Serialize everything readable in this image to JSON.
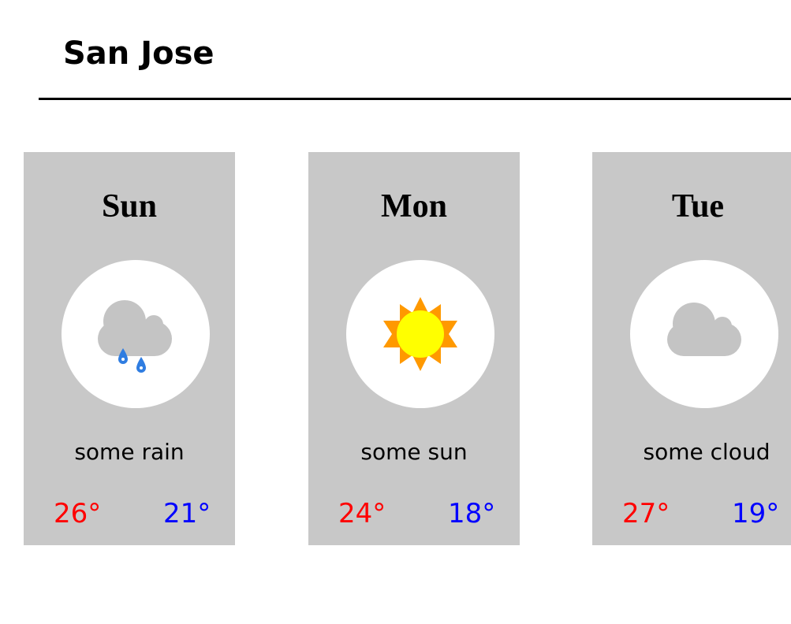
{
  "city": "San Jose",
  "days": [
    {
      "day": "Sun",
      "condition": "some rain",
      "high": "26°",
      "low": "21°",
      "icon": "rain-cloud-icon"
    },
    {
      "day": "Mon",
      "condition": "some sun",
      "high": "24°",
      "low": "18°",
      "icon": "sun-icon"
    },
    {
      "day": "Tue",
      "condition": "some cloud",
      "high": "27°",
      "low": "19°",
      "icon": "cloud-icon"
    }
  ],
  "colors": {
    "card_bg": "#c8c8c8",
    "high_temp": "#ff0000",
    "low_temp": "#0000ff",
    "cloud": "#c4c4c4",
    "rain": "#2f7de1",
    "sun_core": "#ffff00",
    "sun_rays": "#ff9900"
  }
}
